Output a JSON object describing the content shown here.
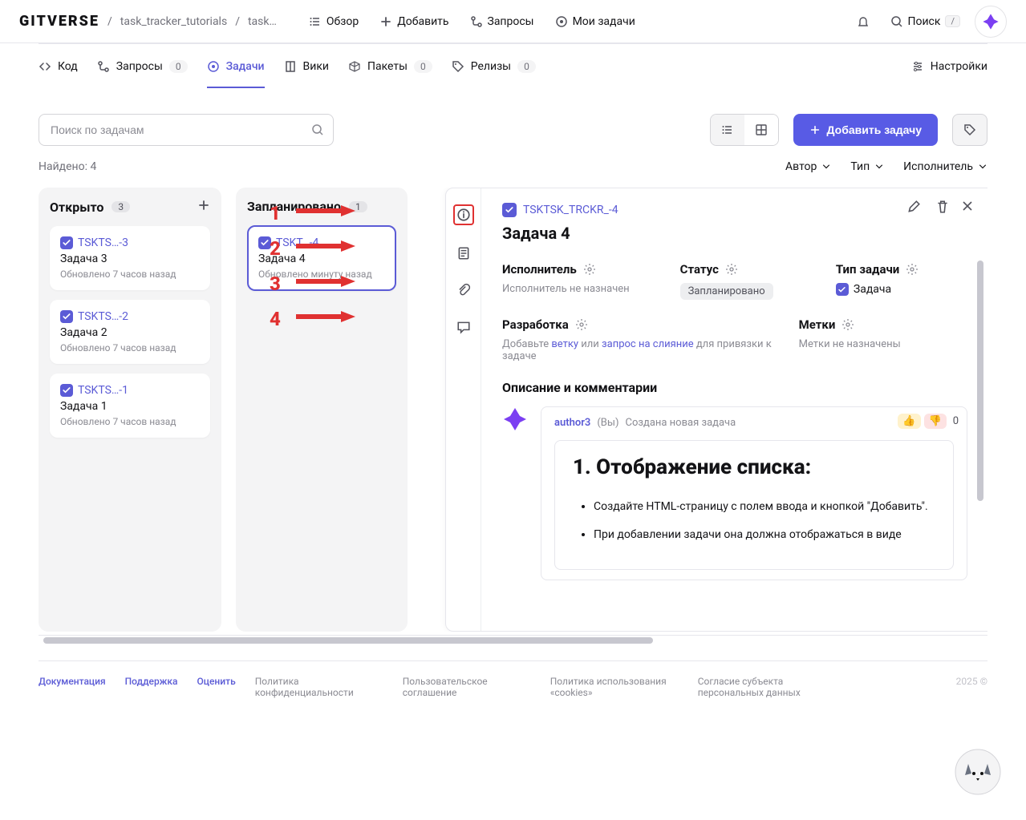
{
  "header": {
    "logo": "GITVERSE",
    "breadcrumb1": "task_tracker_tutorials",
    "breadcrumb2": "task…",
    "nav": {
      "overview": "Обзор",
      "add": "Добавить",
      "requests": "Запросы",
      "mytasks": "Мои задачи",
      "search": "Поиск",
      "search_kbd": "/"
    }
  },
  "tabs": {
    "code": "Код",
    "requests": "Запросы",
    "requests_badge": "0",
    "tasks": "Задачи",
    "wiki": "Вики",
    "packages": "Пакеты",
    "packages_badge": "0",
    "releases": "Релизы",
    "releases_badge": "0",
    "settings": "Настройки"
  },
  "toolbar": {
    "search_ph": "Поиск по задачам",
    "add_task": "Добавить задачу"
  },
  "filters": {
    "found": "Найдено: 4",
    "author": "Автор",
    "type": "Тип",
    "assignee": "Исполнитель"
  },
  "board": {
    "col1": {
      "title": "Открыто",
      "count": "3"
    },
    "col2": {
      "title": "Запланировано",
      "count": "1"
    },
    "cards": {
      "c1": {
        "id": "TSKTS…-3",
        "title": "Задача 3",
        "meta": "Обновлено 7 часов назад"
      },
      "c2": {
        "id": "TSKTS…-2",
        "title": "Задача 2",
        "meta": "Обновлено 7 часов назад"
      },
      "c3": {
        "id": "TSKTS…-1",
        "title": "Задача 1",
        "meta": "Обновлено 7 часов назад"
      },
      "c4": {
        "id": "TSKT…-4",
        "title": "Задача 4",
        "meta": "Обновлено минуту назад"
      }
    }
  },
  "anno": {
    "n1": "1",
    "n2": "2",
    "n3": "3",
    "n4": "4"
  },
  "panel": {
    "id": "TSKTSK_TRCKR_-4",
    "title": "Задача 4",
    "assignee_label": "Исполнитель",
    "assignee_value": "Исполнитель не назначен",
    "status_label": "Статус",
    "status_value": "Запланировано",
    "type_label": "Тип задачи",
    "type_value": "Задача",
    "dev_label": "Разработка",
    "dev_pre": "Добавьте ",
    "dev_branch": "ветку",
    "dev_or": " или ",
    "dev_mr": "запрос на слияние",
    "dev_post": " для привязки к задаче",
    "labels_label": "Метки",
    "labels_value": "Метки не назначены",
    "desc_label": "Описание и комментарии",
    "author": "author3",
    "you": "(Вы)",
    "event": "Создана новая задача",
    "react_n": "0",
    "desc_h1": "1. Отображение списка:",
    "desc_li1": "Создайте HTML-страницу с полем ввода и кнопкой \"Добавить\".",
    "desc_li2": "При добавлении задачи она должна отображаться в виде"
  },
  "footer": {
    "doc": "Документация",
    "support": "Поддержка",
    "rate": "Оценить",
    "priv": "Политика конфиденциальности",
    "agree": "Пользовательское соглашение",
    "cookies": "Политика использования «cookies»",
    "consent": "Согласие субъекта персональных данных",
    "year": "2025 ©"
  }
}
